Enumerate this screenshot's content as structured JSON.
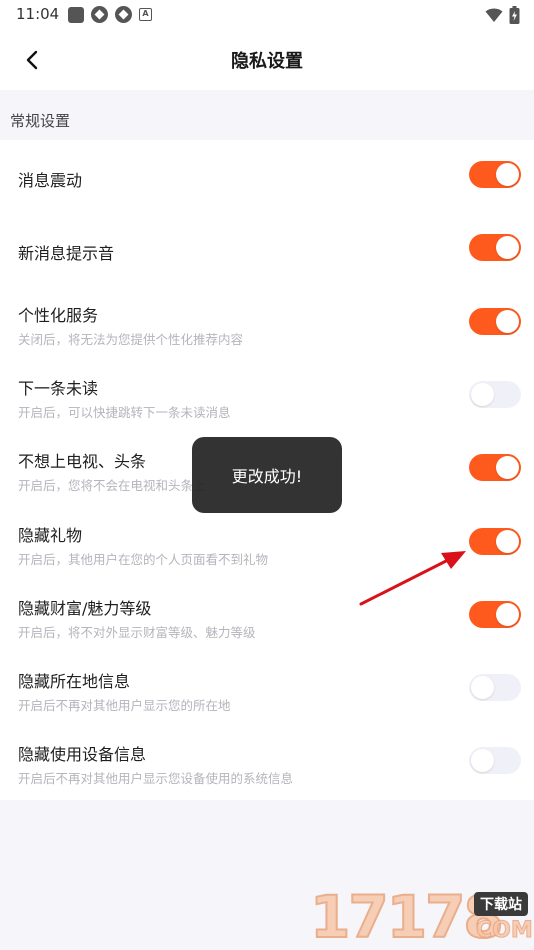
{
  "status_bar": {
    "time": "11:04",
    "icons": [
      "square-icon",
      "pinwheel-icon",
      "pinwheel-icon",
      "a-icon",
      "wifi-icon",
      "battery-icon"
    ]
  },
  "header": {
    "title": "隐私设置",
    "back_icon": "chevron-left-icon"
  },
  "section": {
    "label": "常规设置"
  },
  "settings": [
    {
      "title": "消息震动",
      "desc": "",
      "on": true
    },
    {
      "title": "新消息提示音",
      "desc": "",
      "on": true
    },
    {
      "title": "个性化服务",
      "desc": "关闭后，将无法为您提供个性化推荐内容",
      "on": true
    },
    {
      "title": "下一条未读",
      "desc": "开启后，可以快捷跳转下一条未读消息",
      "on": false
    },
    {
      "title": "不想上电视、头条",
      "desc": "开启后，您将不会在电视和头条上",
      "on": true
    },
    {
      "title": "隐藏礼物",
      "desc": "开启后，其他用户在您的个人页面看不到礼物",
      "on": true
    },
    {
      "title": "隐藏财富/魅力等级",
      "desc": "开启后，将不对外显示财富等级、魅力等级",
      "on": true
    },
    {
      "title": "隐藏所在地信息",
      "desc": "开启后不再对其他用户显示您的所在地",
      "on": false
    },
    {
      "title": "隐藏使用设备信息",
      "desc": "开启后不再对其他用户显示您设备使用的系统信息",
      "on": false
    }
  ],
  "toast": {
    "message": "更改成功!"
  },
  "watermark": {
    "digits": "17178",
    "badge": "下载站",
    "suffix": "COM"
  },
  "colors": {
    "toggle_on": "#fe5a1e",
    "toggle_off": "#f0f1f8",
    "page_bg": "#f6f6fa",
    "arrow": "#d9121a"
  }
}
